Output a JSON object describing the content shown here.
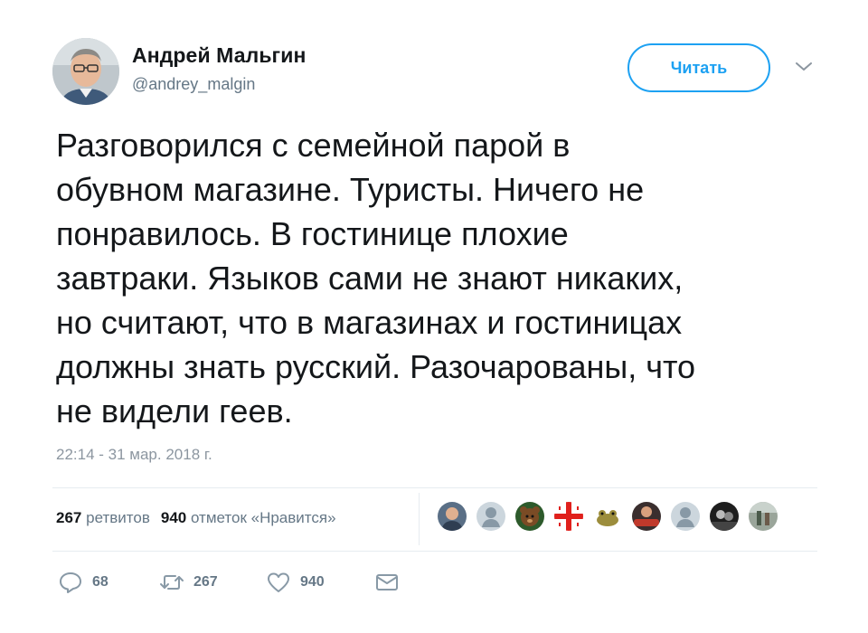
{
  "author": {
    "name": "Андрей Мальгин",
    "handle": "@andrey_malgin"
  },
  "follow_label": "Читать",
  "tweet": {
    "lines": [
      "Разговорился с семейной парой в",
      "обувном магазине. Туристы. Ничего не",
      "понравилось. В гостинице плохие",
      "завтраки. Языков сами не знают никаких,",
      "но считают, что в магазинах и гостиницах",
      "должны знать русский. Разочарованы, что",
      "не видели геев."
    ],
    "timestamp": "22:14 - 31 мар. 2018 г."
  },
  "stats": {
    "retweets_count": "267",
    "retweets_label": "ретвитов",
    "likes_count": "940",
    "likes_label": "отметок «Нравится»"
  },
  "likers": [
    {
      "icon": "user-photo-icon",
      "color": "#8a6a4a"
    },
    {
      "icon": "default-avatar-icon",
      "color": "#ccd6dd"
    },
    {
      "icon": "bear-avatar-icon",
      "color": "#6b4a2a"
    },
    {
      "icon": "georgian-flag-avatar-icon",
      "color": "#e0201c"
    },
    {
      "icon": "frog-avatar-icon",
      "color": "#9a8a3a"
    },
    {
      "icon": "red-badge-avatar-icon",
      "color": "#c0392b"
    },
    {
      "icon": "default-avatar-icon",
      "color": "#ccd6dd"
    },
    {
      "icon": "dark-photo-avatar-icon",
      "color": "#2c2c2c"
    },
    {
      "icon": "street-photo-avatar-icon",
      "color": "#6e7a6a"
    }
  ],
  "actions": {
    "replies": "68",
    "retweets": "267",
    "likes": "940"
  },
  "colors": {
    "accent": "#1da1f2",
    "text": "#14171a",
    "secondary": "#657786"
  }
}
